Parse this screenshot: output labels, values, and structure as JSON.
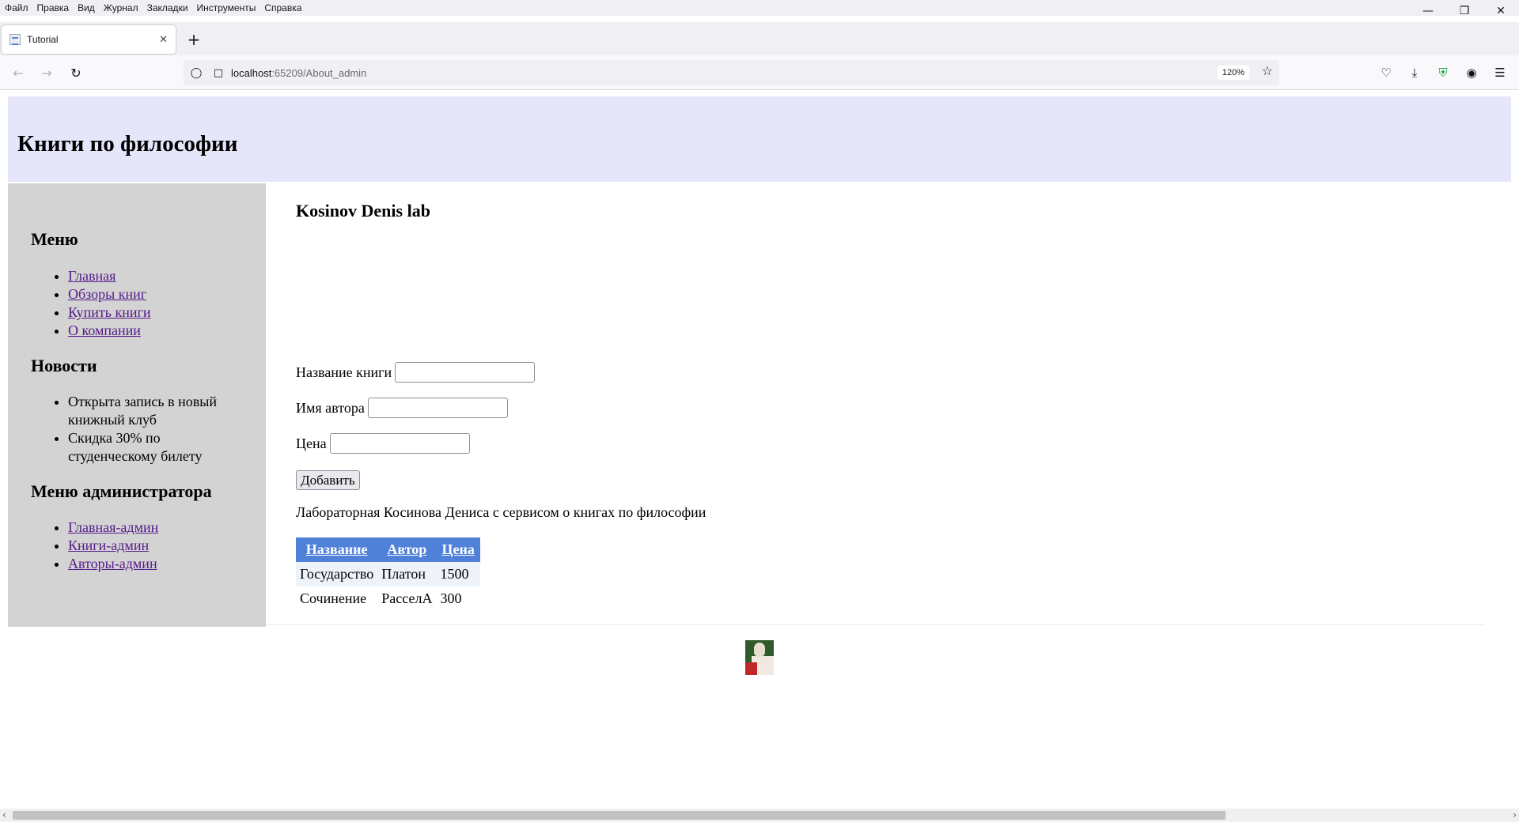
{
  "browser": {
    "menu": [
      "Файл",
      "Правка",
      "Вид",
      "Журнал",
      "Закладки",
      "Инструменты",
      "Справка"
    ],
    "tab_title": "Tutorial",
    "url_host": "localhost",
    "url_path": ":65209/About_admin",
    "zoom": "120%"
  },
  "page": {
    "site_title": "Книги по философии",
    "sidebar": {
      "menu_title": "Меню",
      "menu_links": [
        "Главная",
        "Обзоры книг",
        "Купить книги",
        "О компании"
      ],
      "news_title": "Новости",
      "news_items": [
        "Открыта запись в новый книжный клуб",
        "Скидка 30% по студенческому билету"
      ],
      "admin_title": "Меню администратора",
      "admin_links": [
        "Главная-админ",
        "Книги-админ",
        "Авторы-админ"
      ]
    },
    "main": {
      "heading": "Kosinov Denis lab",
      "form": {
        "book_label": "Название книги",
        "author_label": "Имя автора",
        "price_label": "Цена",
        "book_value": "",
        "author_value": "",
        "price_value": "",
        "add_button": "Добавить"
      },
      "description": "Лабораторная Косинова Дениса с сервисом о книгах по философии",
      "table": {
        "headers": [
          "Название",
          "Автор",
          "Цена"
        ],
        "rows": [
          [
            "Государство",
            "Платон",
            "1500"
          ],
          [
            "Сочинение",
            "РасселА",
            "300"
          ]
        ]
      }
    }
  },
  "colors": {
    "header_bg": "#e6e6fa",
    "sidebar_bg": "#d3d3d3",
    "table_header_bg": "#4f81d8",
    "visited_link": "#551a8b"
  }
}
